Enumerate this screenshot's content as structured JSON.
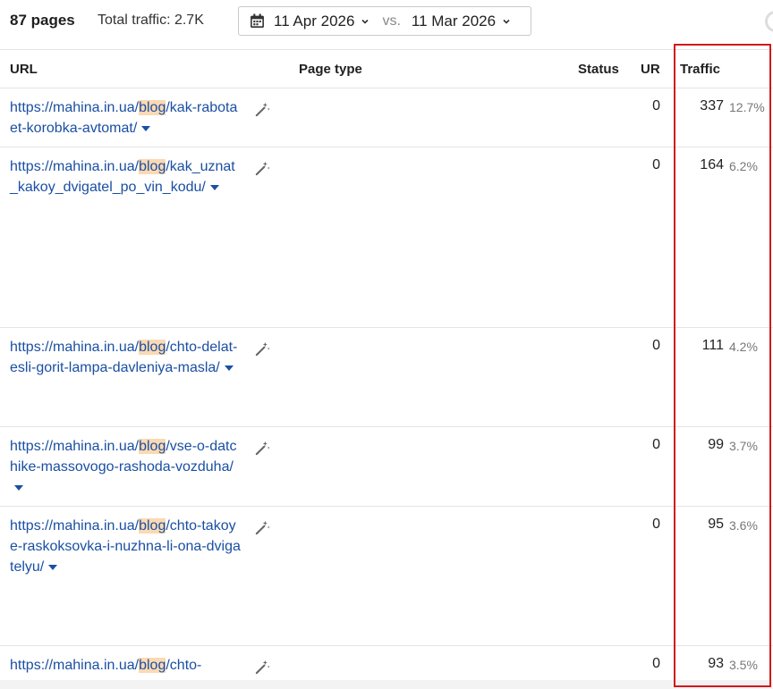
{
  "header": {
    "pages_count": "87 pages",
    "total_traffic": "Total traffic: 2.7K",
    "date_from": "11 Apr 2026",
    "vs": "vs.",
    "date_to": "11 Mar 2026"
  },
  "columns": {
    "url": "URL",
    "page_type": "Page type",
    "status": "Status",
    "ur": "UR",
    "traffic": "Traffic"
  },
  "rows": [
    {
      "url_prefix": "https://mahina.in.ua/",
      "url_hl": "blog",
      "url_rest": "/kak-rabotaet-korobka-avtomat/",
      "ur": "0",
      "traffic": "337",
      "pct": "12.7%"
    },
    {
      "url_prefix": "https://mahina.in.ua/",
      "url_hl": "blog",
      "url_rest": "/kak_uznat_kakoy_dvigatel_po_vin_kodu/",
      "ur": "0",
      "traffic": "164",
      "pct": "6.2%"
    },
    {
      "url_prefix": "https://mahina.in.ua/",
      "url_hl": "blog",
      "url_rest": "/chto-delat-esli-gorit-lampa-davleniya-masla/",
      "ur": "0",
      "traffic": "111",
      "pct": "4.2%"
    },
    {
      "url_prefix": "https://mahina.in.ua/",
      "url_hl": "blog",
      "url_rest": "/vse-o-datchike-massovogo-rashoda-vozduha/",
      "ur": "0",
      "traffic": "99",
      "pct": "3.7%"
    },
    {
      "url_prefix": "https://mahina.in.ua/",
      "url_hl": "blog",
      "url_rest": "/chto-takoye-raskoksovka-i-nuzhna-li-ona-dvigatelyu/",
      "ur": "0",
      "traffic": "95",
      "pct": "3.6%"
    },
    {
      "url_prefix": "https://mahina.in.ua/",
      "url_hl": "blog",
      "url_rest": "/chto-",
      "ur": "0",
      "traffic": "93",
      "pct": "3.5%"
    }
  ],
  "colors": {
    "link": "#1a4fa3",
    "highlight": "#fbd9b3",
    "annotation_box": "#d11a1a"
  }
}
